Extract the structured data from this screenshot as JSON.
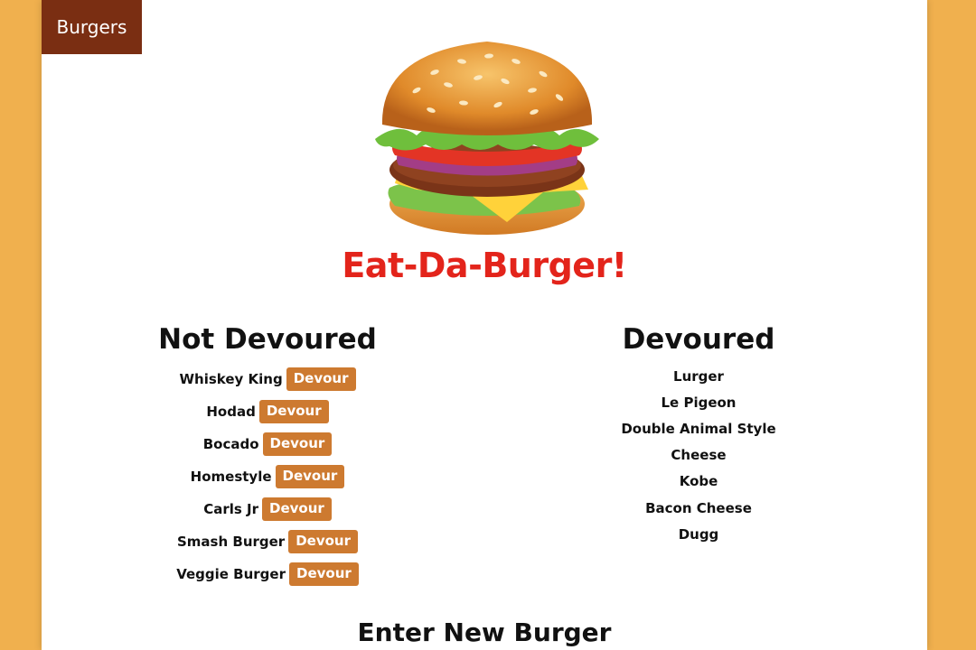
{
  "navbar": {
    "brand": "Burgers"
  },
  "header": {
    "title": "Eat-Da-Burger!"
  },
  "not_devoured": {
    "heading": "Not Devoured",
    "button_label": "Devour",
    "items": [
      "Whiskey King",
      "Hodad",
      "Bocado",
      "Homestyle",
      "Carls Jr",
      "Smash Burger",
      "Veggie Burger"
    ]
  },
  "devoured": {
    "heading": "Devoured",
    "items": [
      "Lurger",
      "Le Pigeon",
      "Double Animal Style",
      "Cheese",
      "Kobe",
      "Bacon Cheese",
      "Dugg"
    ]
  },
  "form": {
    "heading": "Enter New Burger"
  },
  "colors": {
    "background": "#f0b04e",
    "brand_bar": "#7a2e12",
    "title_red": "#e3241b",
    "button": "#cd7a30"
  },
  "icons": {
    "hero": "burger-image"
  }
}
